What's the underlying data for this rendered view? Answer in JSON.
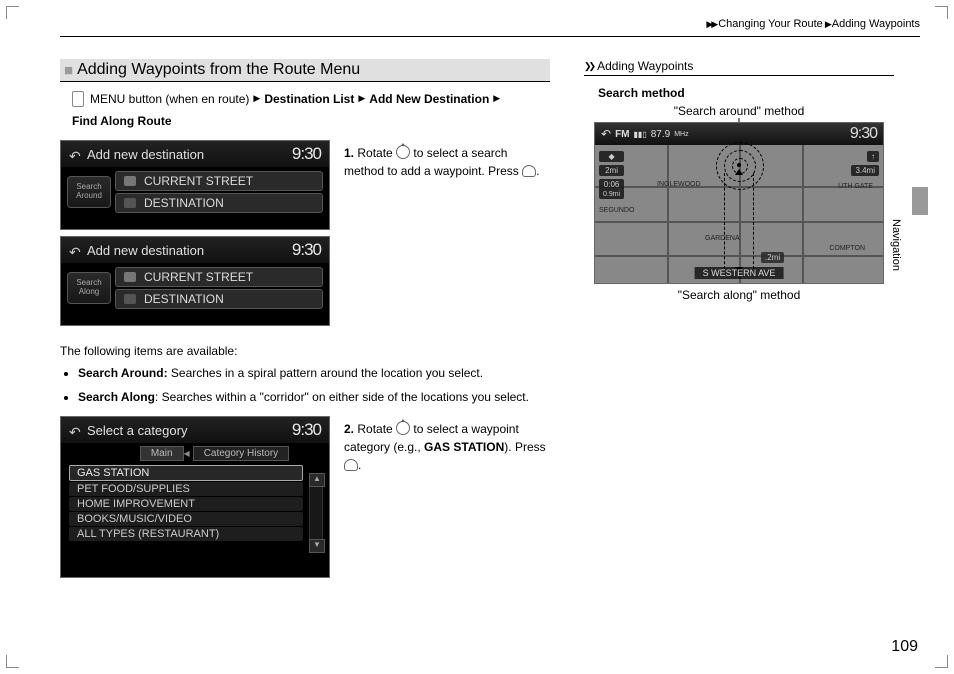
{
  "breadcrumb": {
    "part1": "Changing Your Route",
    "part2": "Adding Waypoints"
  },
  "section_title": "Adding Waypoints from the Route Menu",
  "menu_path": {
    "intro": "MENU button (when en route)",
    "step1": "Destination List",
    "step2": "Add New Destination",
    "step3": "Find Along Route"
  },
  "step1_text_a": "Rotate ",
  "step1_text_b": " to select a search method to add a waypoint. Press ",
  "step1_num": "1.",
  "step2_num": "2.",
  "step2_text_a": "Rotate ",
  "step2_text_b": " to select a waypoint category (e.g., ",
  "step2_bold": "GAS STATION",
  "step2_text_c": "). Press ",
  "screen1": {
    "title": "Add new destination",
    "clock": "9:30",
    "side": "Search Around",
    "items": [
      "CURRENT STREET",
      "DESTINATION"
    ]
  },
  "screen2": {
    "title": "Add new destination",
    "clock": "9:30",
    "side": "Search Along",
    "items": [
      "CURRENT STREET",
      "DESTINATION"
    ]
  },
  "screen3": {
    "title": "Select a category",
    "clock": "9:30",
    "tabs": [
      "Main",
      "Category History"
    ],
    "items": [
      "GAS STATION",
      "PET FOOD/SUPPLIES",
      "HOME IMPROVEMENT",
      "BOOKS/MUSIC/VIDEO",
      "ALL TYPES (RESTAURANT)"
    ]
  },
  "available_intro": "The following items are available:",
  "bullet1_label": "Search Around:",
  "bullet1_text": " Searches in a spiral pattern around the location you select.",
  "bullet2_label": "Search Along",
  "bullet2_text": ": Searches within a \"corridor\" on either side of the locations you select.",
  "sidebar": {
    "header": "Adding Waypoints",
    "title": "Search method",
    "method_top": "\"Search around\" method",
    "method_bottom": "\"Search along\" method",
    "map": {
      "fm_label": "FM",
      "fm_freq": "87.9",
      "fm_unit": "MHz",
      "clock": "9:30",
      "dist_left": "2mi",
      "eta_time": "0:06",
      "eta_dist": "0.9mi",
      "scale_bottom": ".2mi",
      "right_dist": "3.4mi",
      "street": "S WESTERN AVE",
      "city1": "INGLEWOOD",
      "city2": "SEGUNDO",
      "city3": "GARDENA",
      "city4": "COMPTON",
      "city5": "UTH GATE"
    }
  },
  "side_label": "Navigation",
  "page_num": "109",
  "dot": "."
}
